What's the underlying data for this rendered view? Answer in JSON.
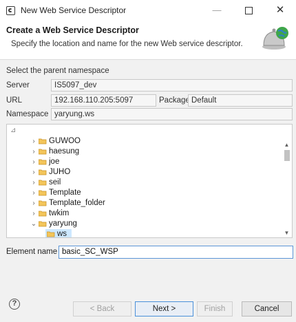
{
  "window": {
    "title": "New Web Service Descriptor",
    "minimize": "—",
    "close": "✕"
  },
  "header": {
    "title": "Create a Web Service Descriptor",
    "description": "Specify the location and name for the new Web service descriptor."
  },
  "parent": {
    "section_label": "Select the parent namespace",
    "server_label": "Server",
    "server_value": "IS5097_dev",
    "url_label": "URL",
    "url_value": "192.168.110.205:5097",
    "package_label": "Package",
    "package_value": "Default",
    "namespace_label": "Namespace",
    "namespace_value": "yaryung.ws"
  },
  "tree": {
    "items": [
      {
        "label": "GUWOO",
        "expanded": false
      },
      {
        "label": "haesung",
        "expanded": false
      },
      {
        "label": "joe",
        "expanded": false
      },
      {
        "label": "JUHO",
        "expanded": false
      },
      {
        "label": "seil",
        "expanded": false
      },
      {
        "label": "Template",
        "expanded": false
      },
      {
        "label": "Template_folder",
        "expanded": false
      },
      {
        "label": "twkim",
        "expanded": false
      },
      {
        "label": "yaryung",
        "expanded": true
      },
      {
        "label": "ws",
        "selected": true
      }
    ]
  },
  "element": {
    "label": "Element name",
    "value": "basic_SC_WSP"
  },
  "buttons": {
    "back": "< Back",
    "next": "Next >",
    "finish": "Finish",
    "cancel": "Cancel"
  },
  "colors": {
    "selection": "#cde8ff",
    "folder": "#e8b84a",
    "focus_border": "#5b95d6"
  }
}
